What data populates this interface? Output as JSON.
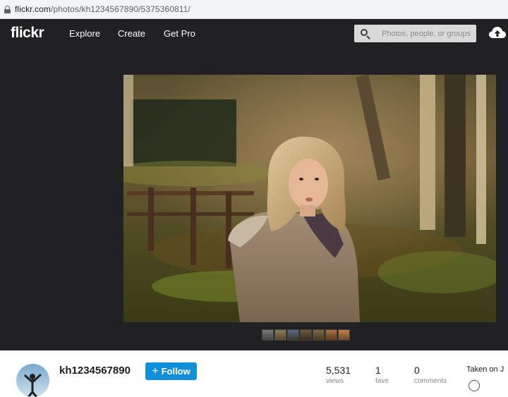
{
  "browser": {
    "url_domain": "flickr.com",
    "url_path": "/photos/kh1234567890/5375360811/"
  },
  "nav": {
    "logo": "flickr",
    "links": [
      "Explore",
      "Create",
      "Get Pro"
    ],
    "search_placeholder": "Photos, people, or groups",
    "upload_icon": "cloud-upload-icon"
  },
  "photo": {
    "thumbnail_count": 7
  },
  "owner": {
    "username": "kh1234567890",
    "follow_label": "Follow"
  },
  "stats": [
    {
      "value": "5,531",
      "label": "views"
    },
    {
      "value": "1",
      "label": "fave"
    },
    {
      "value": "0",
      "label": "comments"
    }
  ],
  "taken_text": "Taken on J"
}
